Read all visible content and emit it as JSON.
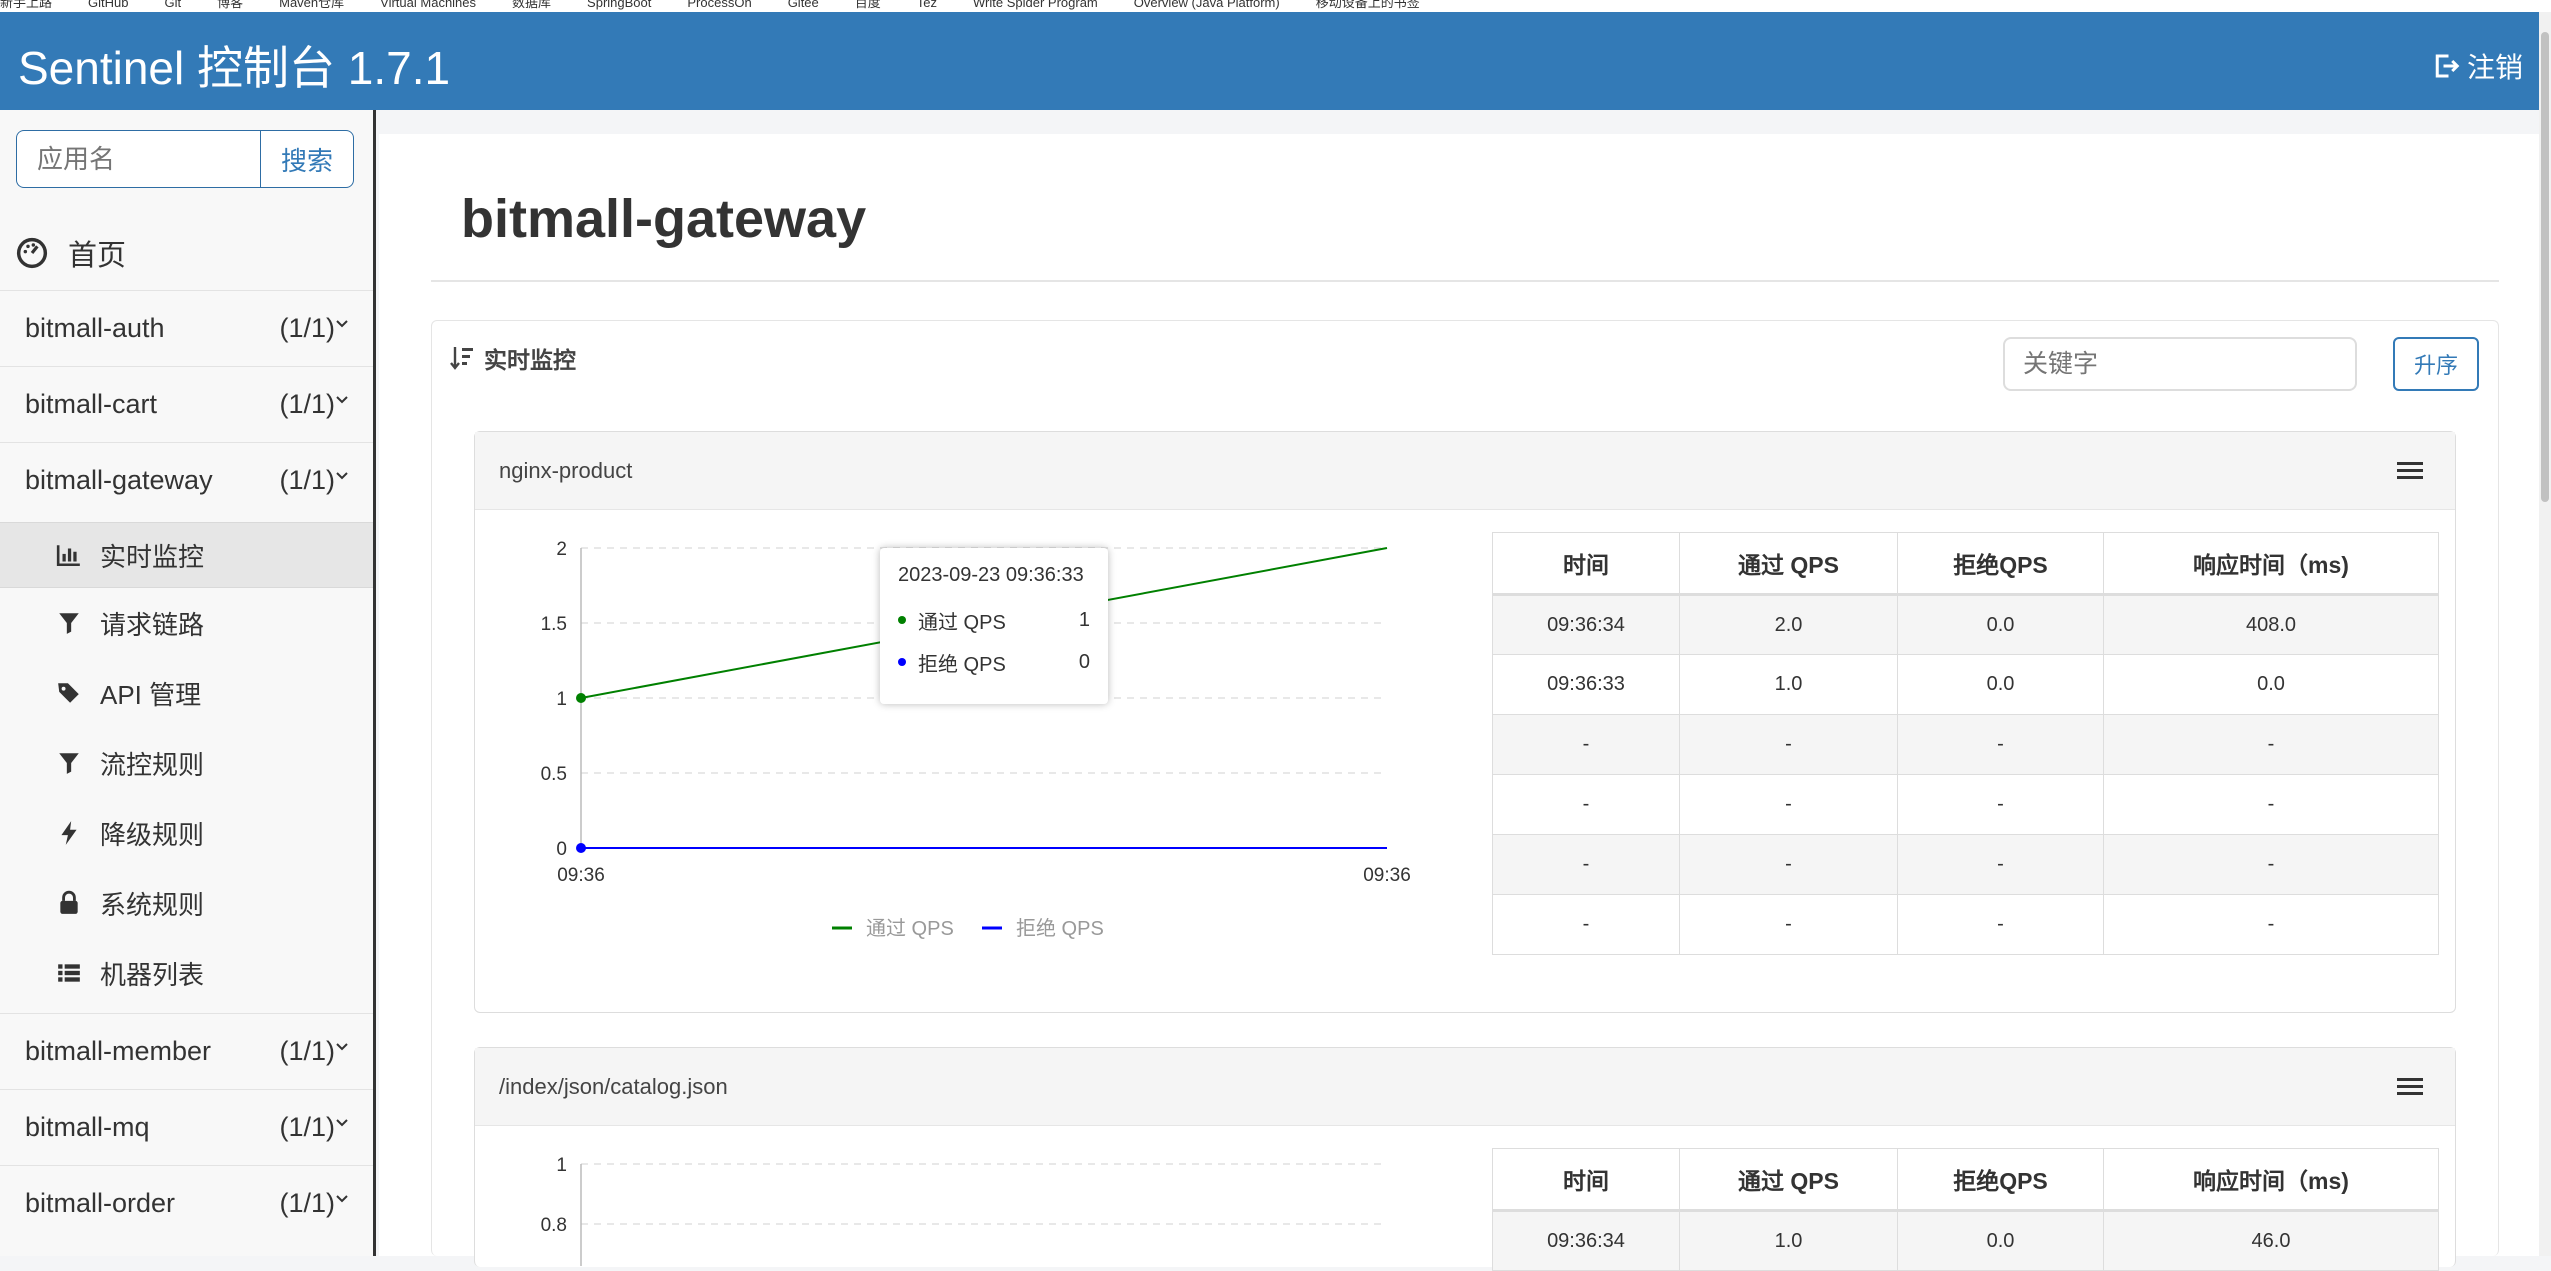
{
  "browser": {
    "bookmarks": [
      "新手上路",
      "GitHub",
      "Git",
      "博客",
      "Maven仓库",
      "Virtual Machines",
      "数据库",
      "SpringBoot",
      "ProcessOn",
      "Gitee",
      "百度",
      "Tez",
      "Write Spider Program",
      "Overview (Java Platform)",
      "移动设备上的书签"
    ]
  },
  "header": {
    "title": "Sentinel 控制台 1.7.1",
    "logout_label": "注销"
  },
  "sidebar": {
    "search_placeholder": "应用名",
    "search_button": "搜索",
    "home_label": "首页",
    "apps": [
      {
        "name": "bitmall-auth",
        "count": "(1/1)"
      },
      {
        "name": "bitmall-cart",
        "count": "(1/1)"
      },
      {
        "name": "bitmall-gateway",
        "count": "(1/1)"
      },
      {
        "name": "bitmall-member",
        "count": "(1/1)"
      },
      {
        "name": "bitmall-mq",
        "count": "(1/1)"
      },
      {
        "name": "bitmall-order",
        "count": "(1/1)"
      }
    ],
    "submenu": [
      {
        "label": "实时监控",
        "icon": "bar-chart-icon",
        "active": true
      },
      {
        "label": "请求链路",
        "icon": "filter-icon"
      },
      {
        "label": "API 管理",
        "icon": "tags-icon"
      },
      {
        "label": "流控规则",
        "icon": "filter-icon"
      },
      {
        "label": "降级规则",
        "icon": "flash-icon"
      },
      {
        "label": "系统规则",
        "icon": "lock-icon"
      },
      {
        "label": "机器列表",
        "icon": "list-icon"
      }
    ]
  },
  "main": {
    "page_title": "bitmall-gateway",
    "panel_title": "实时监控",
    "keyword_placeholder": "关键字",
    "sort_button": "升序",
    "table_headers": [
      "时间",
      "通过 QPS",
      "拒绝QPS",
      "响应时间（ms)"
    ],
    "resources": [
      {
        "name": "nginx-product",
        "rows": [
          [
            "09:36:34",
            "2.0",
            "0.0",
            "408.0"
          ],
          [
            "09:36:33",
            "1.0",
            "0.0",
            "0.0"
          ],
          [
            "-",
            "-",
            "-",
            "-"
          ],
          [
            "-",
            "-",
            "-",
            "-"
          ],
          [
            "-",
            "-",
            "-",
            "-"
          ],
          [
            "-",
            "-",
            "-",
            "-"
          ]
        ],
        "tooltip": {
          "time": "2023-09-23 09:36:33",
          "pass_label": "通过 QPS",
          "pass_value": "1",
          "block_label": "拒绝 QPS",
          "block_value": "0"
        }
      },
      {
        "name": "/index/json/catalog.json",
        "rows": [
          [
            "09:36:34",
            "1.0",
            "0.0",
            "46.0"
          ]
        ]
      }
    ]
  },
  "colors": {
    "brand": "#337ab7",
    "pass_series": "#008000",
    "block_series": "#0000ff"
  },
  "chart_data": [
    {
      "type": "line",
      "x": [
        "09:36:33",
        "09:36:34"
      ],
      "x_tick_labels": [
        "09:36",
        "09:36"
      ],
      "y_ticks": [
        "0",
        "0.5",
        "1",
        "1.5",
        "2"
      ],
      "ylim": [
        0,
        2
      ],
      "series": [
        {
          "name": "通过 QPS",
          "color": "#008000",
          "values": [
            1,
            2
          ]
        },
        {
          "name": "拒绝 QPS",
          "color": "#0000ff",
          "values": [
            0,
            0
          ]
        }
      ],
      "legend": "bottom",
      "grid": true
    },
    {
      "type": "line",
      "y_ticks": [
        "0.8",
        "1"
      ],
      "ylim": [
        0,
        1
      ],
      "series": [],
      "grid": true
    }
  ]
}
